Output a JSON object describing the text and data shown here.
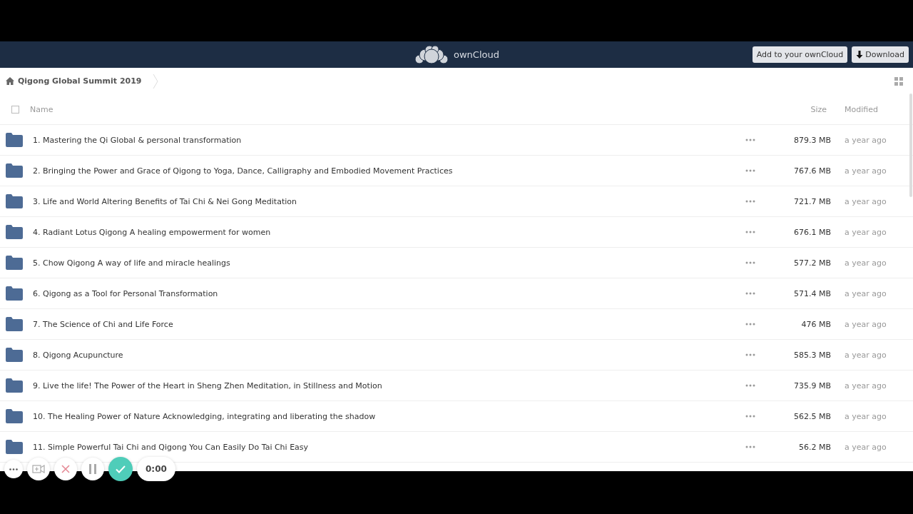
{
  "header": {
    "brand": "ownCloud",
    "buttons": [
      {
        "label": "Add to your ownCloud",
        "kind": "plain"
      },
      {
        "label": "Download",
        "kind": "download"
      }
    ]
  },
  "breadcrumb": {
    "label": "Qigong Global Summit 2019"
  },
  "table": {
    "select_all": {
      "checked": false
    },
    "columns": [
      "Name",
      "Size",
      "Modified"
    ],
    "rows": [
      {
        "name": "1. Mastering the Qi Global & personal transformation",
        "size": "879.3 MB",
        "modified": "a year ago"
      },
      {
        "name": "2. Bringing the Power and Grace of Qigong to Yoga, Dance, Calligraphy and Embodied Movement Practices",
        "size": "767.6 MB",
        "modified": "a year ago"
      },
      {
        "name": "3. Life and World Altering Benefits of Tai Chi & Nei Gong Meditation",
        "size": "721.7 MB",
        "modified": "a year ago"
      },
      {
        "name": "4. Radiant Lotus Qigong A healing empowerment for women",
        "size": "676.1 MB",
        "modified": "a year ago"
      },
      {
        "name": "5. Chow Qigong A way of life and miracle healings",
        "size": "577.2 MB",
        "modified": "a year ago"
      },
      {
        "name": "6. Qigong as a Tool for Personal Transformation",
        "size": "571.4 MB",
        "modified": "a year ago"
      },
      {
        "name": "7. The Science of Chi and Life Force",
        "size": "476 MB",
        "modified": "a year ago"
      },
      {
        "name": "8. Qigong Acupuncture",
        "size": "585.3 MB",
        "modified": "a year ago"
      },
      {
        "name": "9. Live the life! The Power of the Heart in Sheng Zhen Meditation, in Stillness and Motion",
        "size": "735.9 MB",
        "modified": "a year ago"
      },
      {
        "name": "10. The Healing Power of Nature Acknowledging, integrating and liberating the shadow",
        "size": "562.5 MB",
        "modified": "a year ago"
      },
      {
        "name": "11. Simple Powerful Tai Chi and Qigong You Can Easily Do Tai Chi Easy",
        "size": "56.2 MB",
        "modified": "a year ago"
      }
    ]
  },
  "recorder": {
    "time": "0:00"
  }
}
